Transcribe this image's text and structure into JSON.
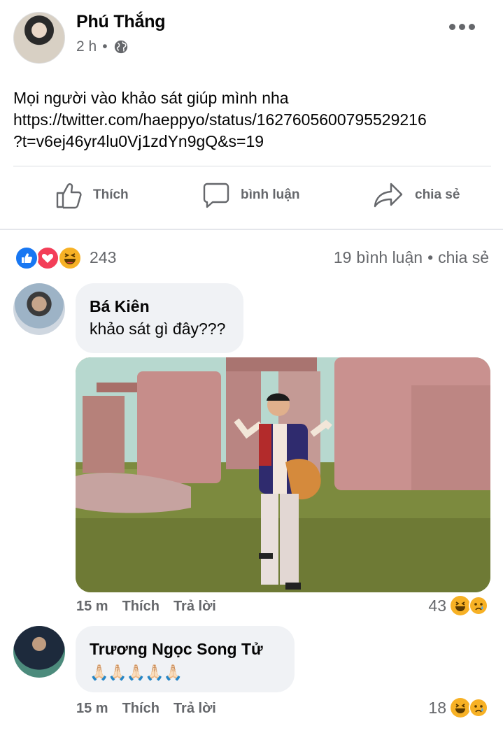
{
  "post": {
    "author": "Phú Thắng",
    "time": "2 h",
    "separator": "•",
    "privacy_icon": "globe-icon",
    "text_lines": [
      "Mọi người vào khảo sát giúp mình nha",
      "https://twitter.com/haeppyo/status/1627605600795529216",
      "?t=v6ej46yr4lu0Vj1zdYn9gQ&s=19"
    ],
    "actions": {
      "like": "Thích",
      "comment": "bình luận",
      "share": "chia sẻ"
    }
  },
  "reactions": {
    "icons": [
      "like-reaction-icon",
      "love-reaction-icon",
      "haha-reaction-icon"
    ],
    "count": "243",
    "comments_count": "19",
    "comments_label": "bình luận",
    "dot": "•",
    "share_label": "chia sẻ"
  },
  "comments": [
    {
      "name": "Bá Kiên",
      "text": "khảo sát gì đây???",
      "has_gif": true,
      "time": "15 m",
      "like": "Thích",
      "reply": "Trả lời",
      "reaction_count": "43",
      "reaction_icons": [
        "haha-icon",
        "sad-icon"
      ]
    },
    {
      "name": "Trương Ngọc Song Tử",
      "text": "🙏🏻🙏🏻🙏🏻🙏🏻🙏🏻",
      "time": "15 m",
      "like": "Thích",
      "reply": "Trả lời",
      "reaction_count": "18",
      "reaction_icons": [
        "haha-icon",
        "sad-icon"
      ]
    }
  ],
  "colors": {
    "secondary_text": "#65676b",
    "bubble_bg": "#f0f2f5",
    "like_blue": "#1877f2",
    "love_red": "#f33e58",
    "haha_yellow": "#f7b125"
  }
}
